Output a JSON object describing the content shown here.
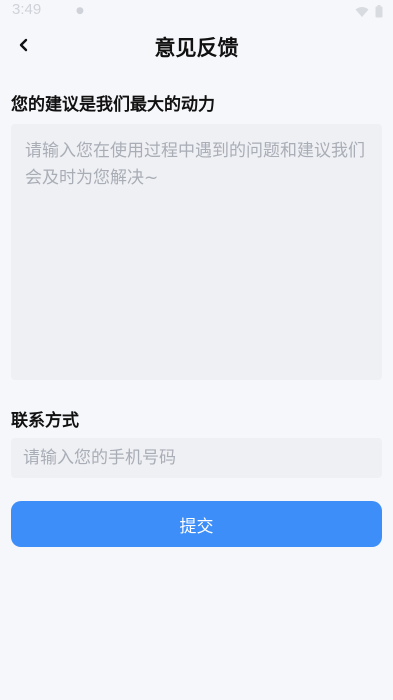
{
  "status_bar": {
    "time": "3:49",
    "icons": [
      "notification-dot-icon",
      "wifi-icon",
      "battery-icon"
    ]
  },
  "header": {
    "title": "意见反馈",
    "back_icon": "chevron-left-icon"
  },
  "feedback": {
    "label": "您的建议是我们最大的动力",
    "placeholder": "请输入您在使用过程中遇到的问题和建议我们会及时为您解决~",
    "value": ""
  },
  "contact": {
    "label": "联系方式",
    "placeholder": "请输入您的手机号码",
    "value": ""
  },
  "submit": {
    "label": "提交"
  },
  "colors": {
    "accent": "#3d8ef8",
    "background": "#f6f7fb",
    "input_background": "#eff0f4",
    "placeholder": "#a9adb6"
  }
}
